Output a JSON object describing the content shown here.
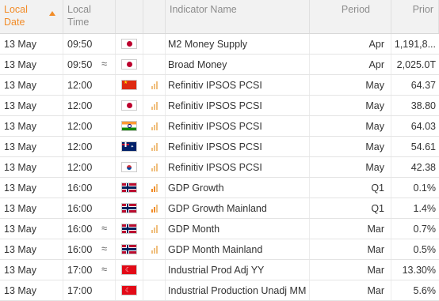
{
  "headers": {
    "date": "Local Date",
    "time": "Local Time",
    "indicator": "Indicator Name",
    "period": "Period",
    "prior": "Prior"
  },
  "accent_color": "#f28c28",
  "rows": [
    {
      "date": "13 May",
      "time": "09:50",
      "approx": "",
      "flag": "jp",
      "importance": 0,
      "name": "M2 Money Supply",
      "period": "Apr",
      "prior": "1,191,8..."
    },
    {
      "date": "13 May",
      "time": "09:50",
      "approx": "≈",
      "flag": "jp",
      "importance": 0,
      "name": "Broad Money",
      "period": "Apr",
      "prior": "2,025.0T"
    },
    {
      "date": "13 May",
      "time": "12:00",
      "approx": "",
      "flag": "cn",
      "importance": 1,
      "name": "Refinitiv IPSOS PCSI",
      "period": "May",
      "prior": "64.37"
    },
    {
      "date": "13 May",
      "time": "12:00",
      "approx": "",
      "flag": "jp",
      "importance": 1,
      "name": "Refinitiv IPSOS PCSI",
      "period": "May",
      "prior": "38.80"
    },
    {
      "date": "13 May",
      "time": "12:00",
      "approx": "",
      "flag": "in",
      "importance": 1,
      "name": "Refinitiv IPSOS PCSI",
      "period": "May",
      "prior": "64.03"
    },
    {
      "date": "13 May",
      "time": "12:00",
      "approx": "",
      "flag": "au",
      "importance": 1,
      "name": "Refinitiv IPSOS PCSI",
      "period": "May",
      "prior": "54.61"
    },
    {
      "date": "13 May",
      "time": "12:00",
      "approx": "",
      "flag": "kr",
      "importance": 1,
      "name": "Refinitiv IPSOS PCSI",
      "period": "May",
      "prior": "42.38"
    },
    {
      "date": "13 May",
      "time": "16:00",
      "approx": "",
      "flag": "no",
      "importance": 2,
      "name": "GDP Growth",
      "period": "Q1",
      "prior": "0.1%"
    },
    {
      "date": "13 May",
      "time": "16:00",
      "approx": "",
      "flag": "no",
      "importance": 2,
      "name": "GDP Growth Mainland",
      "period": "Q1",
      "prior": "1.4%"
    },
    {
      "date": "13 May",
      "time": "16:00",
      "approx": "≈",
      "flag": "no",
      "importance": 1,
      "name": "GDP Month",
      "period": "Mar",
      "prior": "0.7%"
    },
    {
      "date": "13 May",
      "time": "16:00",
      "approx": "≈",
      "flag": "no",
      "importance": 1,
      "name": "GDP Month Mainland",
      "period": "Mar",
      "prior": "0.5%"
    },
    {
      "date": "13 May",
      "time": "17:00",
      "approx": "≈",
      "flag": "tr",
      "importance": 0,
      "name": "Industrial Prod Adj YY",
      "period": "Mar",
      "prior": "13.30%"
    },
    {
      "date": "13 May",
      "time": "17:00",
      "approx": "",
      "flag": "tr",
      "importance": 0,
      "name": "Industrial Production Unadj MM",
      "period": "Mar",
      "prior": "5.6%"
    }
  ]
}
